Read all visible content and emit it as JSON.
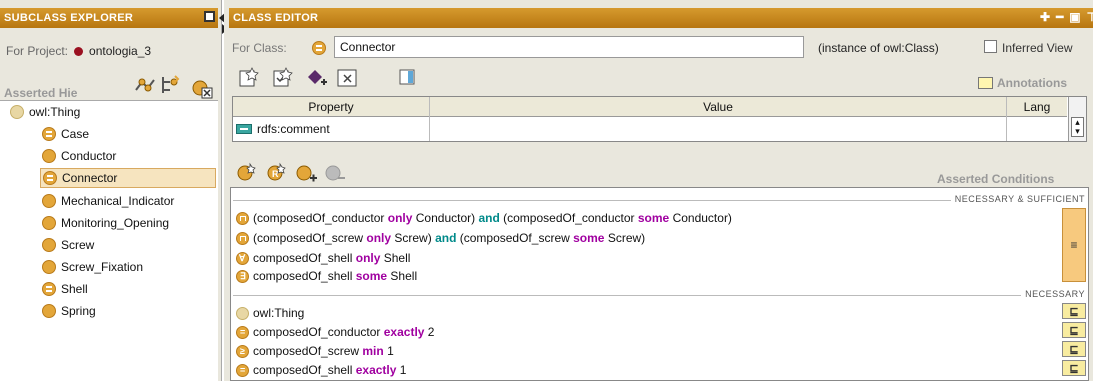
{
  "subclass_explorer": {
    "title": "SUBCLASS EXPLORER",
    "for_project_label": "For Project:",
    "project_name": "ontologia_3",
    "asserted_hierarchy_label": "Asserted Hie",
    "tree": [
      {
        "label": "owl:Thing",
        "marker": ""
      },
      {
        "label": "Case",
        "marker": "≡"
      },
      {
        "label": "Conductor",
        "marker": ""
      },
      {
        "label": "Connector",
        "marker": "≡",
        "selected": true
      },
      {
        "label": "Mechanical_Indicator",
        "marker": ""
      },
      {
        "label": "Monitoring_Opening",
        "marker": ""
      },
      {
        "label": "Screw",
        "marker": ""
      },
      {
        "label": "Screw_Fixation",
        "marker": ""
      },
      {
        "label": "Shell",
        "marker": "≡"
      },
      {
        "label": "Spring",
        "marker": ""
      }
    ]
  },
  "class_editor": {
    "title": "CLASS EDITOR",
    "for_class_label": "For Class:",
    "class_name": "Connector",
    "instance_of": "(instance of owl:Class)",
    "inferred_view_label": "Inferred View",
    "annotations_label": "Annotations",
    "table_headers": [
      "Property",
      "Value",
      "Lang"
    ],
    "annotation_rows": [
      {
        "property": "rdfs:comment",
        "value": "",
        "lang": ""
      }
    ],
    "asserted_conditions_label": "Asserted Conditions",
    "nec_suff_label": "NECESSARY & SUFFICIENT",
    "necessary_label": "NECESSARY",
    "nec_suff_conditions": [
      {
        "parts": [
          "(composedOf_conductor ",
          "only",
          " Conductor) ",
          "and",
          " (composedOf_conductor ",
          "some",
          " Conductor)"
        ]
      },
      {
        "parts": [
          "(composedOf_screw ",
          "only",
          " Screw) ",
          "and",
          " (composedOf_screw ",
          "some",
          " Screw)"
        ]
      },
      {
        "parts": [
          "composedOf_shell ",
          "only",
          " Shell"
        ]
      },
      {
        "parts": [
          "composedOf_shell ",
          "some",
          " Shell"
        ]
      }
    ],
    "necessary_conditions": [
      {
        "parts": [
          "owl:Thing"
        ]
      },
      {
        "parts": [
          "composedOf_conductor ",
          "exactly",
          " 2"
        ]
      },
      {
        "parts": [
          "composedOf_screw ",
          "min",
          " 1"
        ]
      },
      {
        "parts": [
          "composedOf_shell ",
          "exactly",
          " 1"
        ]
      }
    ],
    "equiv_symbol": "≡",
    "subset_symbol": "⊑"
  },
  "colors": {
    "title_bar": "#c4861e",
    "class_dot": "#e3a639",
    "keyword_purple": "#a000a0",
    "keyword_teal": "#008a8a",
    "selection": "#f6e4bf"
  }
}
